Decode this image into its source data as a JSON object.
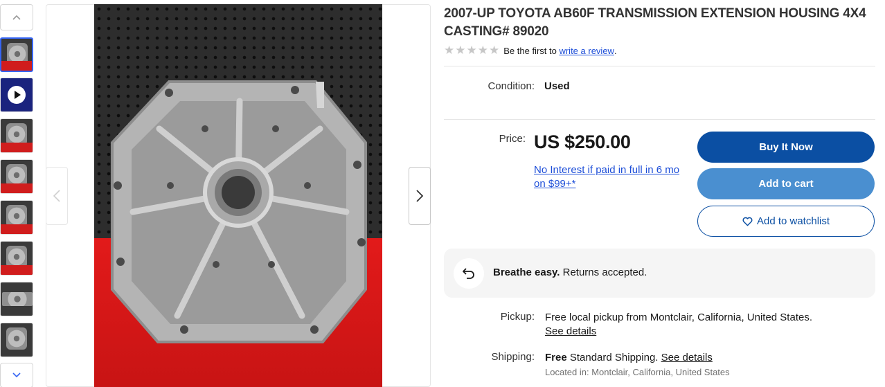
{
  "gallery": {
    "thumbnails": [
      {
        "kind": "image",
        "selected": true
      },
      {
        "kind": "video",
        "selected": false
      },
      {
        "kind": "image",
        "selected": false
      },
      {
        "kind": "image",
        "selected": false
      },
      {
        "kind": "image",
        "selected": false
      },
      {
        "kind": "image",
        "selected": false
      },
      {
        "kind": "image",
        "selected": false
      },
      {
        "kind": "image",
        "selected": false
      }
    ],
    "icons": {
      "up": "chevron-up-icon",
      "down": "chevron-down-icon",
      "prev": "chevron-left-icon",
      "next": "chevron-right-icon",
      "video": "play-icon"
    }
  },
  "item": {
    "title": "2007-UP TOYOTA AB60F TRANSMISSION EXTENSION HOUSING 4X4 CASTING# 89020",
    "rating": {
      "stars": 0,
      "prefix": "Be the first to",
      "link": "write a review",
      "suffix": "."
    },
    "condition": {
      "label": "Condition:",
      "value": "Used"
    },
    "price": {
      "label": "Price:",
      "value": "US $250.00",
      "financing": "No Interest if paid in full in 6 mo on $99+*"
    },
    "actions": {
      "buy_now": "Buy It Now",
      "add_to_cart": "Add to cart",
      "watchlist": "Add to watchlist"
    },
    "returns": {
      "bold": "Breathe easy.",
      "text": "Returns accepted.",
      "icon": "return-arrow-icon"
    },
    "pickup": {
      "label": "Pickup:",
      "text": "Free local pickup from Montclair, California, United States.",
      "link": "See details"
    },
    "shipping": {
      "label": "Shipping:",
      "bold": "Free",
      "text": "Standard Shipping.",
      "link": "See details",
      "location": "Located in: Montclair, California, United States"
    }
  },
  "colors": {
    "primary_button": "#0b4fa3",
    "secondary_button": "#4a8fd0",
    "link": "#1d4ed8",
    "selected_thumb": "#3665f3"
  }
}
